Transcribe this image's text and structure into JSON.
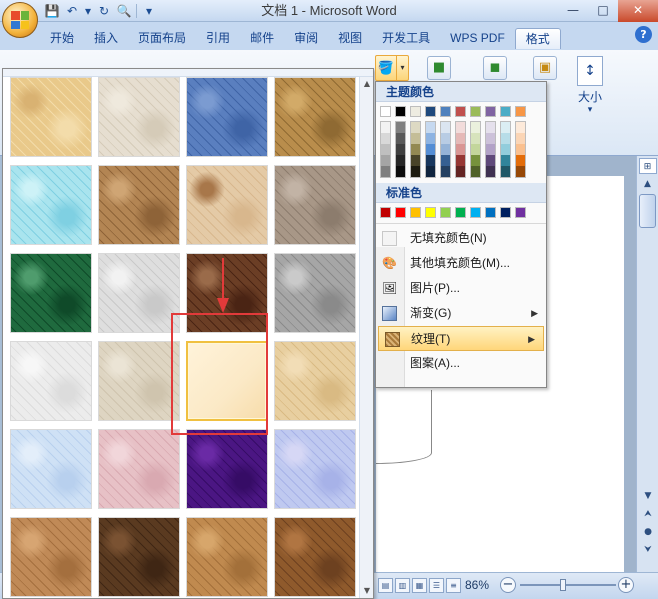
{
  "window": {
    "title": "文档 1 - Microsoft Word",
    "controls": {
      "minimize": "—",
      "maximize": "□",
      "close": "✕"
    }
  },
  "quick_access": {
    "icons": [
      "save-icon",
      "undo-icon",
      "redo-icon",
      "print-preview-icon",
      "customize-icon"
    ],
    "glyphs": {
      "save": "💾",
      "undo": "↶",
      "undo_dd": "▾",
      "redo": "↻",
      "preview": "🔍",
      "customize": "▾"
    }
  },
  "ribbon_tabs": [
    {
      "label": "开始",
      "active": false
    },
    {
      "label": "插入",
      "active": false
    },
    {
      "label": "页面布局",
      "active": false
    },
    {
      "label": "引用",
      "active": false
    },
    {
      "label": "邮件",
      "active": false
    },
    {
      "label": "审阅",
      "active": false
    },
    {
      "label": "视图",
      "active": false
    },
    {
      "label": "开发工具",
      "active": false
    },
    {
      "label": "WPS PDF",
      "active": false
    },
    {
      "label": "格式",
      "active": true
    }
  ],
  "help_glyph": "?",
  "ribbon": {
    "size_group_label": "大小",
    "size_group_dropdown": "▾"
  },
  "fill_button": {
    "icon_glyph": "🪣",
    "dropdown_glyph": "▾"
  },
  "fill_menu": {
    "theme_colors_header": "主题颜色",
    "theme_colors_top": [
      "#ffffff",
      "#000000",
      "#eeece1",
      "#1f497d",
      "#4f81bd",
      "#c0504d",
      "#9bbb59",
      "#8064a2",
      "#4bacc6",
      "#f79646"
    ],
    "theme_color_shades": [
      [
        "#f2f2f2",
        "#d8d8d8",
        "#bfbfbf",
        "#a5a5a5",
        "#7f7f7f"
      ],
      [
        "#7f7f7f",
        "#595959",
        "#3f3f3f",
        "#262626",
        "#0c0c0c"
      ],
      [
        "#ddd9c3",
        "#c4bd97",
        "#938953",
        "#494429",
        "#1d1b10"
      ],
      [
        "#c6d9f0",
        "#8db3e2",
        "#548dd4",
        "#17365d",
        "#0f243e"
      ],
      [
        "#dbe5f1",
        "#b8cce4",
        "#95b3d7",
        "#366092",
        "#244061"
      ],
      [
        "#f2dcdb",
        "#e5b9b7",
        "#d99694",
        "#953734",
        "#632423"
      ],
      [
        "#ebf1dd",
        "#d7e3bc",
        "#c3d69b",
        "#76923c",
        "#4f6128"
      ],
      [
        "#e5e0ec",
        "#ccc1d9",
        "#b2a2c7",
        "#5f497a",
        "#3f3151"
      ],
      [
        "#dbeef3",
        "#b7dde8",
        "#92cddc",
        "#31859b",
        "#205867"
      ],
      [
        "#fdeada",
        "#fbd5b5",
        "#fac08f",
        "#e36c09",
        "#974806"
      ]
    ],
    "standard_colors_header": "标准色",
    "standard_colors": [
      "#c00000",
      "#ff0000",
      "#ffc000",
      "#ffff00",
      "#92d050",
      "#00b050",
      "#00b0f0",
      "#0070c0",
      "#002060",
      "#7030a0"
    ],
    "items": [
      {
        "label": "无填充颜色(N)",
        "icon": "no-fill-icon",
        "glyph": "",
        "submenu": false
      },
      {
        "label": "其他填充颜色(M)...",
        "icon": "color-palette-icon",
        "glyph": "🎨",
        "submenu": false
      },
      {
        "label": "图片(P)...",
        "icon": "picture-icon",
        "glyph": "🖼",
        "submenu": false
      },
      {
        "label": "渐变(G)",
        "icon": "gradient-icon",
        "glyph": "▣",
        "submenu": true
      },
      {
        "label": "纹理(T)",
        "icon": "texture-icon",
        "glyph": "▦",
        "submenu": true,
        "highlighted": true
      },
      {
        "label": "图案(A)...",
        "icon": "",
        "glyph": "",
        "submenu": false
      }
    ],
    "submenu_arrow": "▶"
  },
  "texture_gallery": {
    "textures": [
      {
        "name": "papyrus",
        "colors": [
          "#e9c98a",
          "#f3dcaa",
          "#d9b272"
        ]
      },
      {
        "name": "canvas",
        "colors": [
          "#e6ded0",
          "#d5cbb8",
          "#efe9dd"
        ]
      },
      {
        "name": "denim",
        "colors": [
          "#5a7fbf",
          "#3f64a6",
          "#7b9bd1"
        ]
      },
      {
        "name": "woven-mat",
        "colors": [
          "#b98d4c",
          "#8f6a33",
          "#d2aa68"
        ]
      },
      {
        "name": "water-droplets",
        "colors": [
          "#a9e4ee",
          "#7fd0e2",
          "#cdf2f7"
        ]
      },
      {
        "name": "paper-bag",
        "colors": [
          "#b38553",
          "#8e6338",
          "#cfa574"
        ]
      },
      {
        "name": "fish-fossil",
        "colors": [
          "#e4caa6",
          "#d8b78d",
          "#a8774a"
        ]
      },
      {
        "name": "sand",
        "colors": [
          "#a89787",
          "#8c7c6d",
          "#c2b3a5"
        ]
      },
      {
        "name": "green-marble",
        "colors": [
          "#1f6a3e",
          "#0f4a29",
          "#4f9c6d"
        ]
      },
      {
        "name": "white-marble",
        "colors": [
          "#dedede",
          "#c9c9c9",
          "#f2f2f2"
        ]
      },
      {
        "name": "brown-marble",
        "colors": [
          "#6b3e25",
          "#4a2414",
          "#9a6b4a"
        ]
      },
      {
        "name": "granite",
        "colors": [
          "#a6a6a6",
          "#8a8a8a",
          "#cacaca"
        ]
      },
      {
        "name": "newsprint",
        "colors": [
          "#ececec",
          "#dcdcdc",
          "#f7f7f7"
        ]
      },
      {
        "name": "recycled-paper",
        "colors": [
          "#ded5c2",
          "#cfc4ae",
          "#ebe4d5"
        ]
      },
      {
        "name": "parchment",
        "colors": [
          "#fbe9c6",
          "#f7dcaa",
          "#fff3da"
        ]
      },
      {
        "name": "stationery",
        "colors": [
          "#e8cfa0",
          "#d9ba83",
          "#f2ddb6"
        ]
      },
      {
        "name": "blue-tissue-paper",
        "colors": [
          "#cfe1f5",
          "#b8d0ee",
          "#e3eefa"
        ]
      },
      {
        "name": "pink-tissue-paper",
        "colors": [
          "#e7c1c6",
          "#d9a9b1",
          "#f1d6da"
        ]
      },
      {
        "name": "purple-mesh",
        "colors": [
          "#4b1683",
          "#360c66",
          "#6a2aa5"
        ]
      },
      {
        "name": "bouquet",
        "colors": [
          "#bfc9f0",
          "#a7b2e8",
          "#d6d7f5"
        ]
      },
      {
        "name": "cork",
        "colors": [
          "#c08a57",
          "#a46f3e",
          "#d7a572"
        ]
      },
      {
        "name": "walnut",
        "colors": [
          "#5a3a20",
          "#3f2614",
          "#7a5232"
        ]
      },
      {
        "name": "oak",
        "colors": [
          "#c08a4f",
          "#a3703a",
          "#d7a66b"
        ]
      },
      {
        "name": "medium-wood",
        "colors": [
          "#8f5a2c",
          "#6d4120",
          "#b07542"
        ]
      }
    ],
    "selected_index": 14,
    "scroll_glyphs": {
      "up": "▲",
      "down": "▼"
    }
  },
  "vertical_scroll_glyphs": {
    "up": "▲",
    "down": "▼",
    "prev": "⮝",
    "browse": "●",
    "next": "⮟"
  },
  "status_bar": {
    "zoom": "86%",
    "view_glyphs": [
      "▤",
      "▥",
      "▦",
      "☰",
      "≡"
    ],
    "zoom_minus": "−",
    "zoom_plus": "+"
  }
}
